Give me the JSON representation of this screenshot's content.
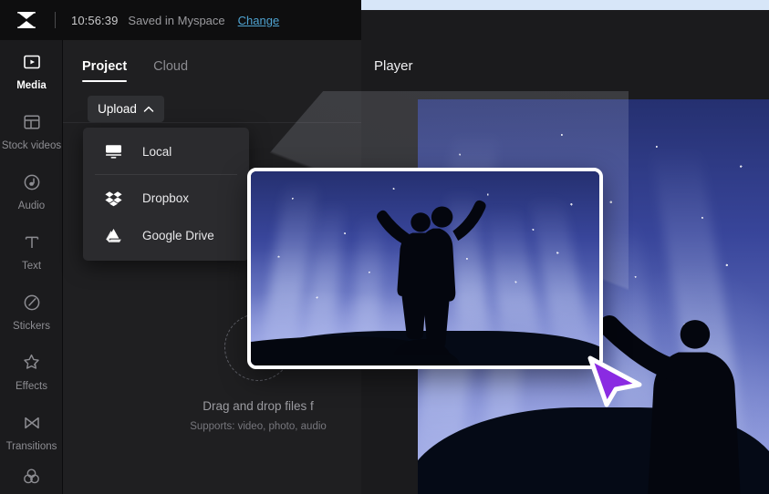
{
  "app": {
    "brand_icon": "capcut-logo-icon",
    "accent_link": "#4fa3d1",
    "cursor_color": "#8a2be2"
  },
  "titlebar": {
    "time": "10:56:39",
    "saved_label": "Saved in Myspace",
    "change_label": "Change"
  },
  "sidebar": {
    "items": [
      {
        "label": "Media",
        "icon": "media-play-icon",
        "active": true
      },
      {
        "label": "Stock videos",
        "icon": "layout-grid-icon",
        "active": false
      },
      {
        "label": "Audio",
        "icon": "music-note-icon",
        "active": false
      },
      {
        "label": "Text",
        "icon": "text-t-icon",
        "active": false
      },
      {
        "label": "Stickers",
        "icon": "sticker-circle-icon",
        "active": false
      },
      {
        "label": "Effects",
        "icon": "sparkle-star-icon",
        "active": false
      },
      {
        "label": "Transitions",
        "icon": "transitions-bowtie-icon",
        "active": false
      },
      {
        "label": "",
        "icon": "filters-circles-icon",
        "active": false
      }
    ]
  },
  "panel": {
    "tabs": [
      {
        "label": "Project",
        "active": true
      },
      {
        "label": "Cloud",
        "active": false
      }
    ],
    "upload": {
      "label": "Upload",
      "chevron": "chevron-up-icon",
      "expanded": true,
      "menu": [
        {
          "label": "Local",
          "icon": "monitor-icon"
        },
        {
          "label": "Dropbox",
          "icon": "dropbox-icon"
        },
        {
          "label": "Google Drive",
          "icon": "google-drive-icon"
        }
      ]
    },
    "dropzone": {
      "icon": "upload-arrow-icon",
      "title": "Drag and drop files f",
      "subtitle": "Supports: video, photo, audio"
    }
  },
  "player": {
    "title": "Player"
  },
  "drag": {
    "thumbnail_alt": "aurora-silhouette-clip"
  }
}
